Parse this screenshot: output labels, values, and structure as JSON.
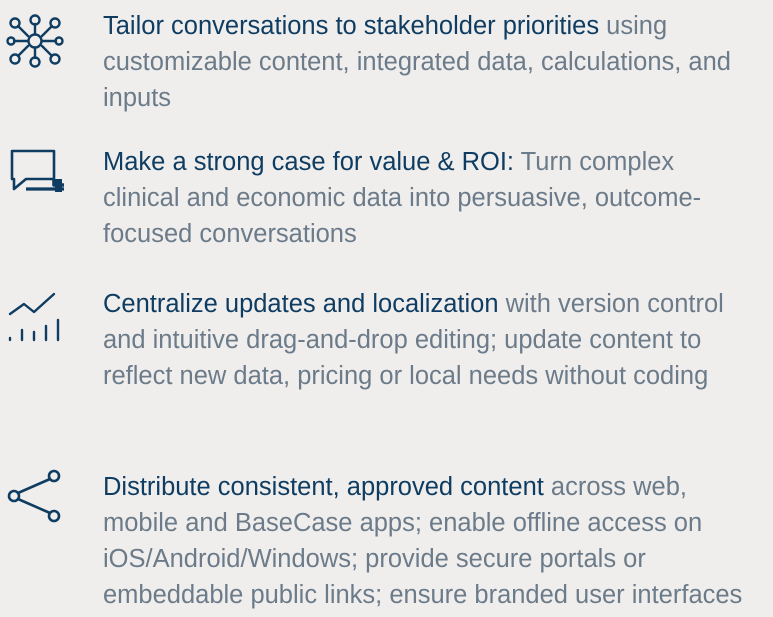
{
  "items": [
    {
      "icon": "network-nodes-icon",
      "highlight": "Tailor conversations to stakeholder priorities",
      "rest": " using customizable content, integrated data, calculations, and inputs"
    },
    {
      "icon": "chat-bubbles-icon",
      "highlight": "Make a strong case for value & ROI:",
      "rest": " Turn complex clinical and economic data into persuasive, outcome-focused conversations"
    },
    {
      "icon": "growth-chart-icon",
      "highlight": "Centralize updates and localization",
      "rest": " with version control and intuitive drag-and-drop editing; update content to reflect new data, pricing or local needs without coding"
    },
    {
      "icon": "share-icon",
      "highlight": "Distribute consistent, approved content",
      "rest": " across web, mobile and BaseCase apps; enable offline access on iOS/Android/Windows; provide secure portals or embeddable public links; ensure branded user interfaces"
    }
  ],
  "colors": {
    "background": "#f0eeed",
    "highlight": "#0f3d62",
    "body_text": "#6b7b89",
    "icon": "#0f3d62"
  }
}
